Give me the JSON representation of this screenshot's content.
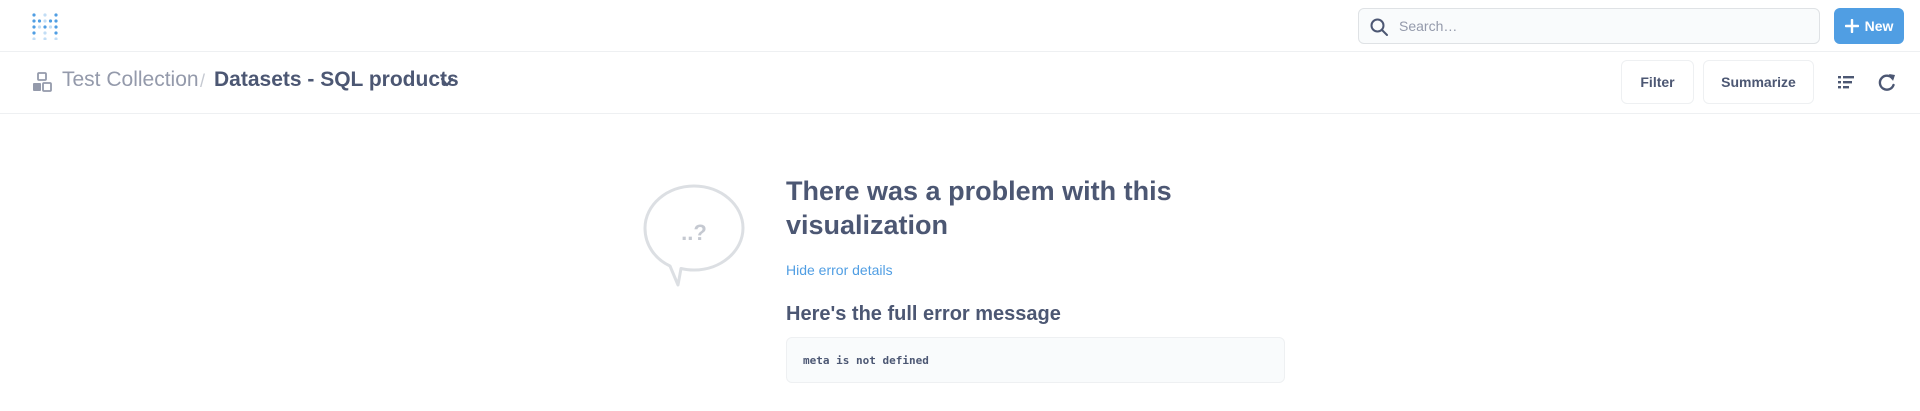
{
  "topbar": {
    "search_placeholder": "Search…",
    "new_label": "New"
  },
  "header": {
    "collection": "Test Collection",
    "separator": "/",
    "title": "Datasets - SQL products",
    "filter_label": "Filter",
    "summarize_label": "Summarize"
  },
  "error": {
    "bubble_text": "..?",
    "title": "There was a problem with this visualization",
    "hide_details_label": "Hide error details",
    "full_message_heading": "Here's the full error message",
    "message": "meta is not defined"
  },
  "colors": {
    "brand": "#509ee3",
    "text_dark": "#4c5773",
    "text_light": "#949aab",
    "border": "#eef0f2"
  },
  "icons": {
    "logo": "metabase-logo",
    "search": "search-icon",
    "new": "plus-icon",
    "collection": "collection-icon",
    "chevron": "chevron-down-icon",
    "list": "list-icon",
    "refresh": "refresh-icon"
  }
}
